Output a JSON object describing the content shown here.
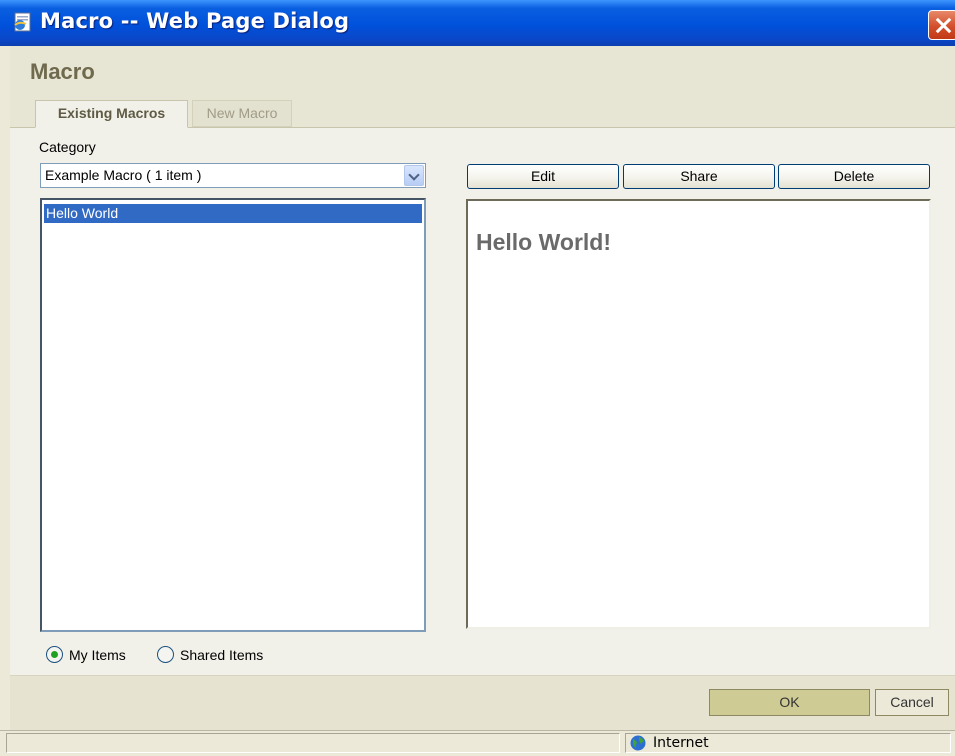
{
  "window": {
    "title": "Macro -- Web Page Dialog",
    "close_icon": "close-icon"
  },
  "header": {
    "page_title": "Macro"
  },
  "tabs": [
    {
      "label": "Existing Macros",
      "active": true
    },
    {
      "label": "New Macro",
      "active": false
    }
  ],
  "category": {
    "label": "Category",
    "selected": "Example Macro  ( 1 item )"
  },
  "macro_list": {
    "items": [
      "Hello World"
    ],
    "selected_index": 0
  },
  "actions": {
    "edit": "Edit",
    "share": "Share",
    "delete": "Delete"
  },
  "preview": {
    "heading": "Hello World!"
  },
  "filter": {
    "options": [
      {
        "label": "My Items",
        "checked": true
      },
      {
        "label": "Shared Items",
        "checked": false
      }
    ]
  },
  "footer": {
    "ok": "OK",
    "cancel": "Cancel"
  },
  "statusbar": {
    "status_text": "",
    "zone": "Internet"
  },
  "colors": {
    "titlebar": "#0A5FE0",
    "selection": "#316AC5",
    "ok_button": "#CFCB95"
  }
}
